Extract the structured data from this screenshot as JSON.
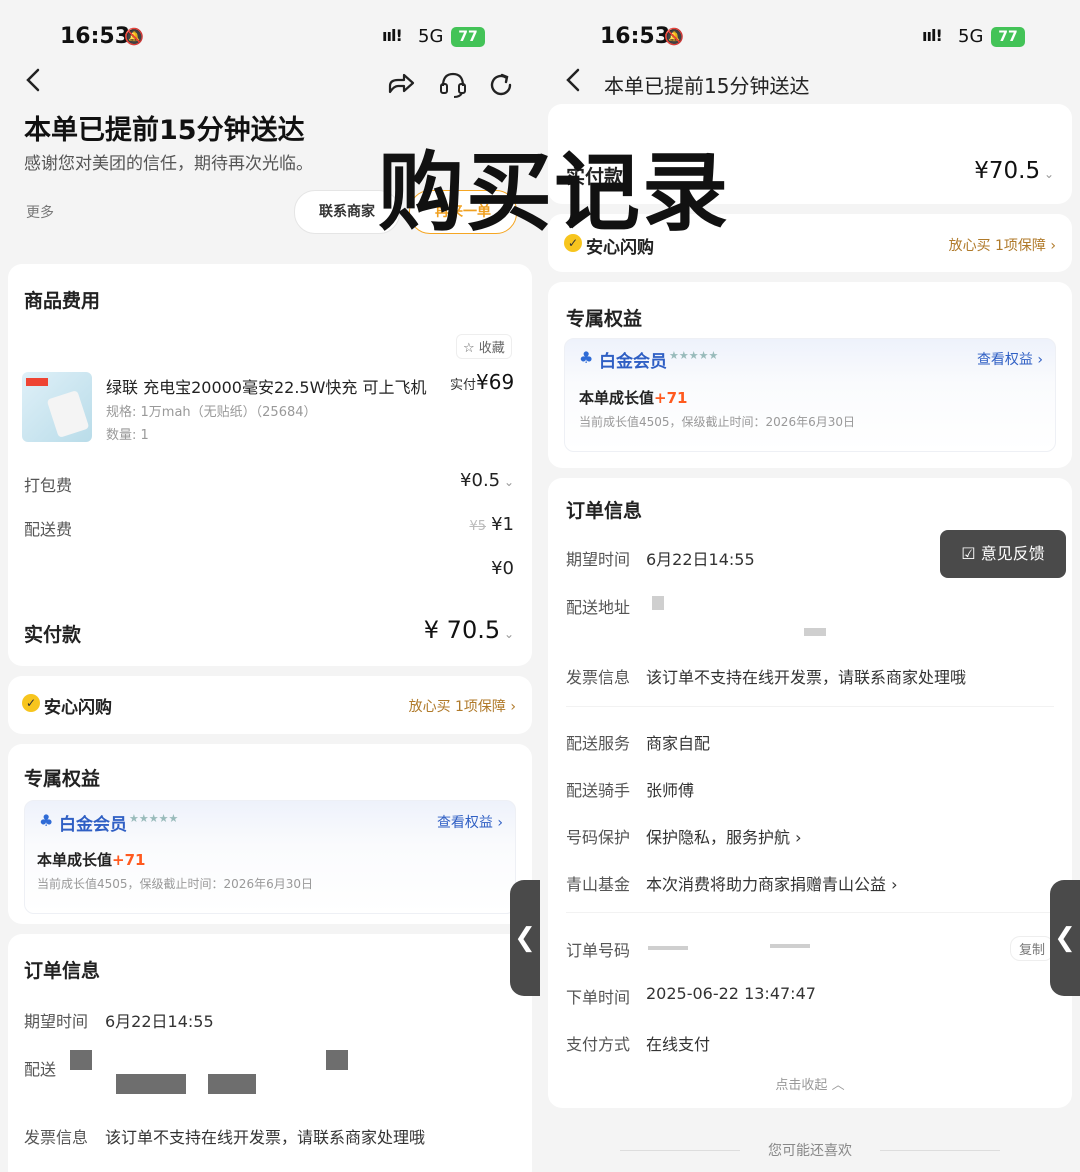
{
  "status": {
    "time": "16:53",
    "network": "5G",
    "battery": "77"
  },
  "overlay_title": "购买记录",
  "left": {
    "header": {
      "title": "本单已提前15分钟送达",
      "subtitle": "感谢您对美团的信任，期待再次光临。",
      "more": "更多",
      "contact_button": "联系商家",
      "reorder_button": "再来一单"
    },
    "goods": {
      "section_title": "商品费用",
      "favorite_label": "收藏",
      "product_name": "绿联 充电宝20000毫安22.5W快充 可上飞机",
      "spec": "规格: 1万mah（无贴纸）（25684）",
      "quantity": "数量: 1",
      "price_prefix": "实付",
      "price": "¥69",
      "packing_label": "打包费",
      "packing_value": "¥0.5",
      "delivery_label": "配送费",
      "delivery_original": "¥5",
      "delivery_value": "¥1",
      "discount_value": "¥0",
      "total_label": "实付款",
      "total_value": "¥ 70.5"
    },
    "assurance": {
      "label": "安心闪购",
      "link": "放心买 1项保障"
    },
    "benefits": {
      "section_title": "专属权益",
      "member_label": "白金会员",
      "view_link": "查看权益",
      "growth_label": "本单成长值",
      "growth_value": "+71",
      "growth_note": "当前成长值4505，保级截止时间：2026年6月30日"
    },
    "order": {
      "section_title": "订单信息",
      "expect_label": "期望时间",
      "expect_value": "6月22日14:55",
      "address_label": "配送",
      "invoice_label": "发票信息",
      "invoice_value": "该订单不支持在线开发票，请联系商家处理哦"
    }
  },
  "right": {
    "header": {
      "title": "本单已提前15分钟送达"
    },
    "total_label": "实付款",
    "total_value": "¥70.5",
    "assurance": {
      "label": "安心闪购",
      "link": "放心买 1项保障"
    },
    "benefits": {
      "section_title": "专属权益",
      "member_label": "白金会员",
      "view_link": "查看权益",
      "growth_label": "本单成长值",
      "growth_value": "+71",
      "growth_note": "当前成长值4505，保级截止时间：2026年6月30日"
    },
    "order": {
      "section_title": "订单信息",
      "rows": [
        {
          "label": "期望时间",
          "value": "6月22日14:55"
        },
        {
          "label": "配送地址",
          "value": ""
        },
        {
          "label": "发票信息",
          "value": "该订单不支持在线开发票，请联系商家处理哦"
        },
        {
          "label": "配送服务",
          "value": "商家自配"
        },
        {
          "label": "配送骑手",
          "value": "张师傅"
        },
        {
          "label": "号码保护",
          "value": "保护隐私，服务护航 ›"
        },
        {
          "label": "青山基金",
          "value": "本次消费将助力商家捐赠青山公益 ›"
        },
        {
          "label": "订单号码",
          "value": ""
        },
        {
          "label": "下单时间",
          "value": "2025-06-22 13:47:47"
        },
        {
          "label": "支付方式",
          "value": "在线支付"
        }
      ],
      "copy_label": "复制",
      "collapse_label": "点击收起",
      "feedback_button": "意见反馈"
    },
    "recommend_label": "您可能还喜欢"
  }
}
